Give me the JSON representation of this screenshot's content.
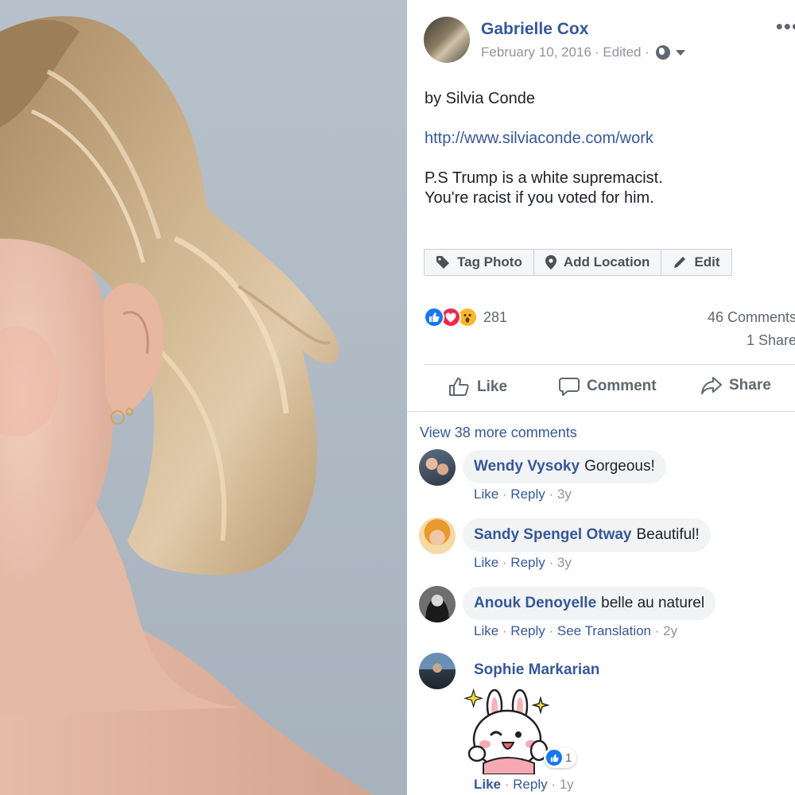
{
  "post": {
    "author": "Gabrielle Cox",
    "date": "February 10, 2016",
    "edited": "· Edited ·",
    "more_icon": "•••",
    "line1": "by Silvia Conde",
    "link": "http://www.silviaconde.com/work",
    "line3": "P.S Trump is a white supremacist.",
    "line4": "You're racist if you voted for him."
  },
  "photo_actions": {
    "tag_photo": "Tag Photo",
    "add_location": "Add Location",
    "edit": "Edit"
  },
  "stats": {
    "reaction_icons": [
      "like-reaction-icon",
      "love-reaction-icon",
      "wow-reaction-icon"
    ],
    "reactions_count": "281",
    "comments_count": "46 Comments",
    "shares_count": "1 Share"
  },
  "footer": {
    "like": "Like",
    "comment": "Comment",
    "share": "Share"
  },
  "comments": {
    "view_more": "View 38 more comments",
    "items": [
      {
        "author": "Wendy Vysoky",
        "text": "Gorgeous!",
        "like": "Like",
        "reply": "Reply",
        "time": "3y"
      },
      {
        "author": "Sandy Spengel Otway",
        "text": "Beautiful!",
        "like": "Like",
        "reply": "Reply",
        "time": "3y"
      },
      {
        "author": "Anouk Denoyelle",
        "text": "belle au naturel",
        "like": "Like",
        "reply": "Reply",
        "translate": "See Translation",
        "time": "2y"
      },
      {
        "author": "Sophie Markarian",
        "sticker": "bunny-sticker",
        "likes": "1",
        "like": "Like",
        "reply": "Reply",
        "time": "1y"
      }
    ]
  },
  "colors": {
    "link_blue": "#365899",
    "like_blue": "#1877f2",
    "love_red": "#f0284a",
    "wow_yellow": "#f7b928",
    "meta_gray": "#90949c",
    "bubble_bg": "#f2f3f5"
  }
}
